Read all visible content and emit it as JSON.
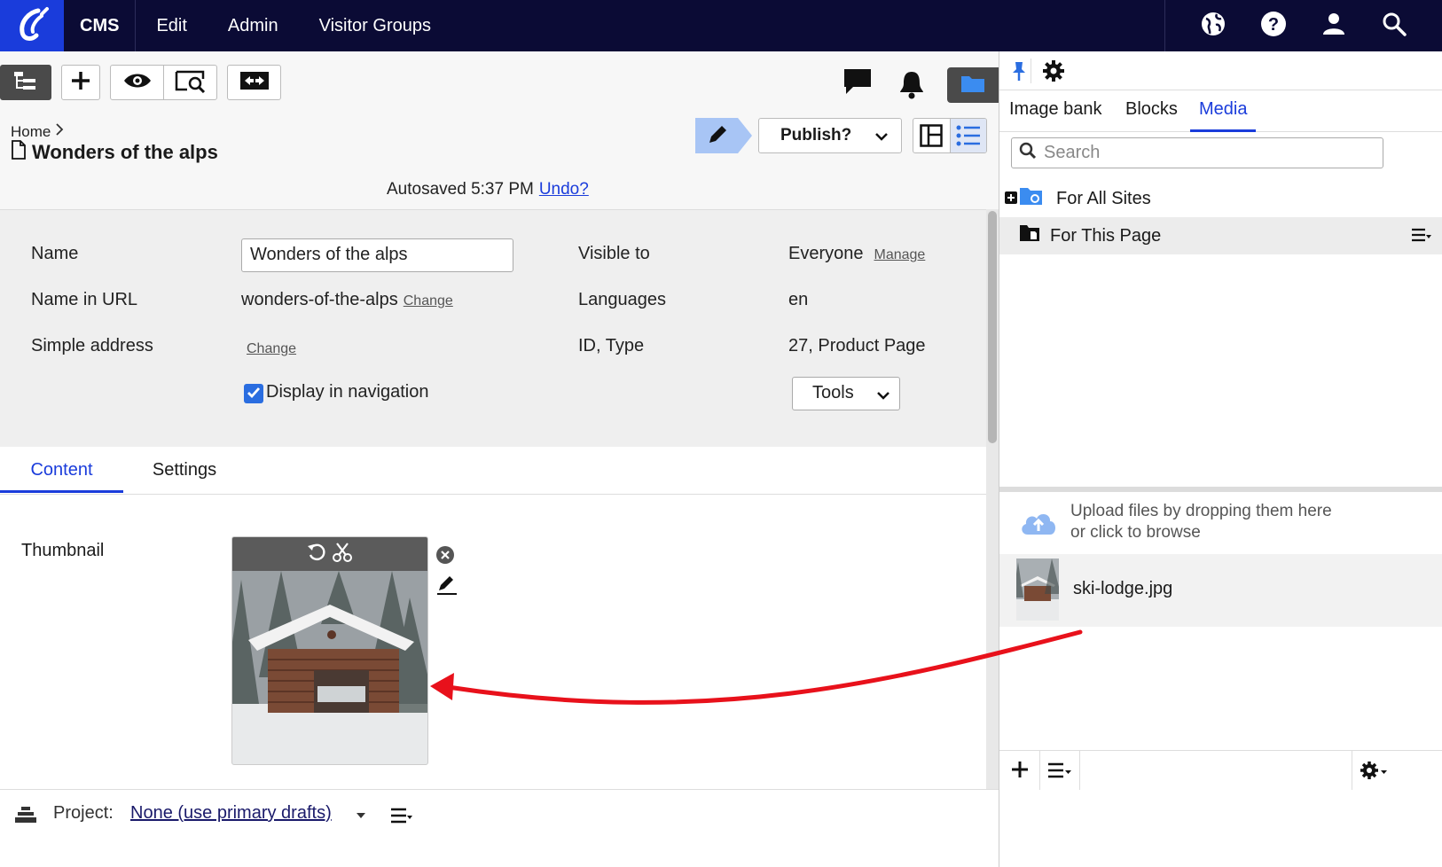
{
  "topnav": {
    "items": [
      "CMS",
      "Edit",
      "Admin",
      "Visitor Groups"
    ]
  },
  "breadcrumb": {
    "home": "Home"
  },
  "page": {
    "title": "Wonders of the alps"
  },
  "autosave": {
    "text": "Autosaved 5:37 PM",
    "undo": "Undo?"
  },
  "publish": {
    "label": "Publish?"
  },
  "properties": {
    "name_label": "Name",
    "name_value": "Wonders of the alps",
    "url_label": "Name in URL",
    "url_value": "wonders-of-the-alps",
    "change": "Change",
    "simple_label": "Simple address",
    "display_nav": "Display in navigation",
    "visible_label": "Visible to",
    "visible_value": "Everyone",
    "manage": "Manage",
    "languages_label": "Languages",
    "languages_value": "en",
    "id_label": "ID, Type",
    "id_value": "27, Product Page",
    "tools": "Tools"
  },
  "tabs": [
    "Content",
    "Settings"
  ],
  "content": {
    "thumbnail_label": "Thumbnail"
  },
  "bottom": {
    "project_label": "Project:",
    "project_value": "None (use primary drafts)"
  },
  "rightpanel": {
    "tabs": [
      "Image bank",
      "Blocks",
      "Media"
    ],
    "search_placeholder": "Search",
    "tree": [
      "For All Sites",
      "For This Page"
    ],
    "upload_line1": "Upload files by dropping them here",
    "upload_line2": "or click to browse",
    "file": "ski-lodge.jpg"
  },
  "colors": {
    "topbar": "#0b0b35",
    "accent": "#1a3cdb",
    "arrow": "#e8111b"
  }
}
